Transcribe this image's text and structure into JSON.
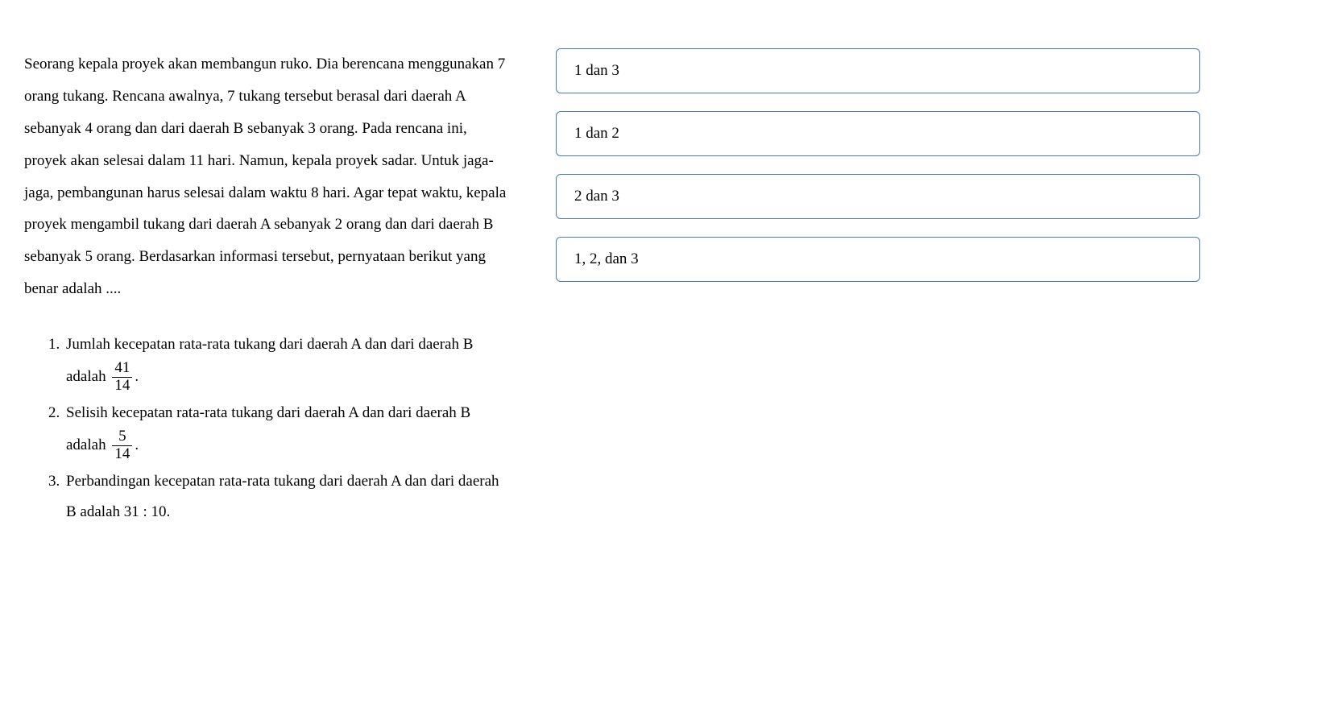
{
  "question": {
    "paragraph": "Seorang kepala proyek akan membangun ruko. Dia berencana menggunakan 7 orang tukang. Rencana awalnya, 7 tukang tersebut berasal dari daerah A sebanyak 4 orang dan dari daerah B sebanyak 3 orang. Pada rencana ini, proyek akan selesai dalam 11 hari. Namun, kepala proyek sadar. Untuk jaga-jaga, pembangunan harus selesai dalam waktu 8 hari. Agar tepat waktu, kepala proyek mengambil tukang dari daerah A sebanyak 2 orang dan dari daerah B sebanyak 5 orang. Berdasarkan informasi tersebut, pernyataan berikut yang benar adalah ....",
    "statements": [
      {
        "num": "1.",
        "pre": "Jumlah kecepatan rata-rata tukang dari daerah A dan dari daerah B adalah ",
        "frac_num": "41",
        "frac_den": "14",
        "post": "."
      },
      {
        "num": "2.",
        "pre": "Selisih kecepatan rata-rata tukang dari daerah A dan dari daerah B adalah ",
        "frac_num": "5",
        "frac_den": "14",
        "post": "."
      },
      {
        "num": "3.",
        "pre": "Perbandingan kecepatan rata-rata tukang dari daerah A dan dari daerah B adalah 31 : 10.",
        "frac_num": "",
        "frac_den": "",
        "post": ""
      }
    ]
  },
  "options": [
    {
      "label": "1 dan 3"
    },
    {
      "label": "1 dan 2"
    },
    {
      "label": "2 dan 3"
    },
    {
      "label": "1, 2, dan 3"
    }
  ]
}
